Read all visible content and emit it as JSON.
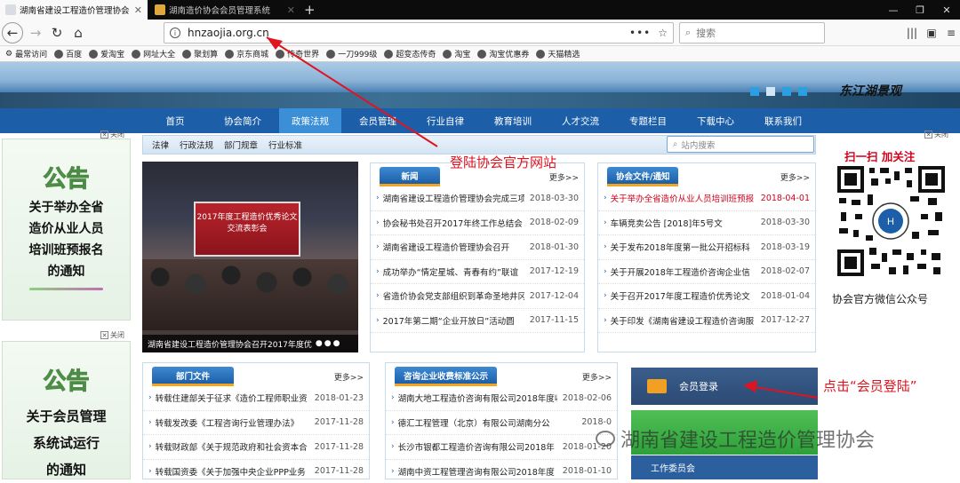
{
  "browser": {
    "tabs": [
      {
        "title": "湖南省建设工程造价管理协会",
        "active": true
      },
      {
        "title": "湖南造价协会会员管理系统",
        "active": false
      }
    ],
    "new_tab": "+",
    "url": "hnzaojia.org.cn",
    "url_menu": "•••",
    "search_placeholder": "搜索",
    "bookmarks": [
      "最常访问",
      "百度",
      "爱淘宝",
      "网址大全",
      "聚划算",
      "京东商城",
      "传奇世界",
      "一刀999级",
      "超变态传奇",
      "淘宝",
      "淘宝优惠券",
      "天猫精选"
    ]
  },
  "banner": {
    "title": "东江湖景观"
  },
  "menu": {
    "items": [
      "首页",
      "协会简介",
      "政策法规",
      "会员管理",
      "行业自律",
      "教育培训",
      "人才交流",
      "专题栏目",
      "下载中心",
      "联系我们"
    ],
    "active_index": 2
  },
  "submenu": {
    "items": [
      "法律",
      "行政法规",
      "部门规章",
      "行业标准"
    ],
    "search_placeholder": "站内搜索"
  },
  "ads": {
    "close_label": "关闭",
    "left_top": {
      "heading": "公告",
      "lines": [
        "关于举办全省",
        "造价从业人员",
        "培训班预报名",
        "的通知"
      ]
    },
    "left_bottom": {
      "heading": "公告",
      "lines": [
        "关于会员管理",
        "系统试运行",
        "的通知"
      ]
    }
  },
  "photo": {
    "screen_text": [
      "2017年度工程造价优秀论文",
      "交流表彰会"
    ],
    "caption": "湖南省建设工程造价管理协会召开2017年度优"
  },
  "news": {
    "title": "新闻",
    "more": "更多>>",
    "rows": [
      {
        "t": "湖南省建设工程造价管理协会完成三项",
        "d": "2018-03-30"
      },
      {
        "t": "协会秘书处召开2017年终工作总结会",
        "d": "2018-02-09"
      },
      {
        "t": "湖南省建设工程造价管理协会召开",
        "d": "2018-01-30"
      },
      {
        "t": "成功举办“情定星城、青春有约”联谊",
        "d": "2017-12-19"
      },
      {
        "t": "省造价协会党支部组织到革命圣地井冈",
        "d": "2017-12-04"
      },
      {
        "t": "2017年第二期“企业开放日”活动圆",
        "d": "2017-11-15"
      }
    ]
  },
  "notices": {
    "title": "协会文件/通知",
    "more": "更多>>",
    "rows": [
      {
        "t": "关于举办全省造价从业人员培训班预报",
        "d": "2018-04-01",
        "red": true
      },
      {
        "t": "车辆竞卖公告 [2018]年5号文",
        "d": "2018-03-30"
      },
      {
        "t": "关于发布2018年度第一批公开招标科",
        "d": "2018-03-19"
      },
      {
        "t": "关于开展2018年工程造价咨询企业信",
        "d": "2018-02-07"
      },
      {
        "t": "关于召开2017年度工程造价优秀论文",
        "d": "2018-01-04"
      },
      {
        "t": "关于印发《湖南省建设工程造价咨询服",
        "d": "2017-12-27"
      }
    ]
  },
  "dept_docs": {
    "title": "部门文件",
    "more": "更多>>",
    "rows": [
      {
        "t": "转载住建部关于征求《造价工程师职业资",
        "d": "2018-01-23"
      },
      {
        "t": "转载发改委《工程咨询行业管理办法》",
        "d": "2017-11-28"
      },
      {
        "t": "转载财政部《关于规范政府和社会资本合",
        "d": "2017-11-28"
      },
      {
        "t": "转载国资委《关于加强中央企业PPP业务",
        "d": "2017-11-28"
      }
    ]
  },
  "fees": {
    "title": "咨询企业收费标准公示",
    "more": "更多>>",
    "rows": [
      {
        "t": "湖南大地工程造价咨询有限公司2018年度收费",
        "d": "2018-02-06"
      },
      {
        "t": "德汇工程管理（北京）有限公司湖南分公",
        "d": "2018-0"
      },
      {
        "t": "长沙市银都工程造价咨询有限公司2018年",
        "d": "2018-01-20"
      },
      {
        "t": "湖南中资工程管理咨询有限公司2018年度",
        "d": "2018-01-10"
      }
    ]
  },
  "qr": {
    "title": "扫一扫  加关注",
    "label": "协会官方微信公众号"
  },
  "login": {
    "label": "会员登录",
    "committee": "工作委员会"
  },
  "annotations": {
    "site": "登陆协会官方网站",
    "login": "点击“会员登陆”"
  },
  "watermark": "湖南省建设工程造价管理协会",
  "colors": {
    "menu": "#1c5fa8",
    "annotation": "#e0131f"
  }
}
